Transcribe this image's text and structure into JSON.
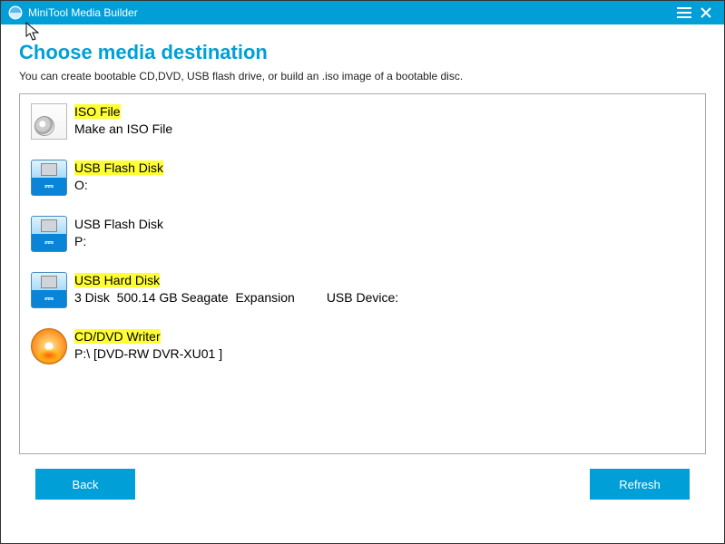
{
  "titlebar": {
    "title": "MiniTool Media Builder"
  },
  "page": {
    "heading": "Choose media destination",
    "subtitle": "You can create bootable CD,DVD, USB flash drive, or build an .iso image of a bootable disc."
  },
  "items": [
    {
      "title": "ISO File",
      "highlight": true,
      "sub": "Make an ISO File",
      "icon": "iso"
    },
    {
      "title": "USB Flash Disk",
      "highlight": true,
      "sub": "O:",
      "icon": "usb"
    },
    {
      "title": "USB Flash Disk",
      "highlight": false,
      "sub": "P:",
      "icon": "usb"
    },
    {
      "title": "USB Hard Disk",
      "highlight": true,
      "sub": "3 Disk  500.14 GB Seagate  Expansion         USB Device:",
      "icon": "usb"
    },
    {
      "title": "CD/DVD Writer",
      "highlight": true,
      "sub": "P:\\ [DVD-RW DVR-XU01 ]",
      "icon": "dvd"
    }
  ],
  "buttons": {
    "back": "Back",
    "refresh": "Refresh"
  }
}
